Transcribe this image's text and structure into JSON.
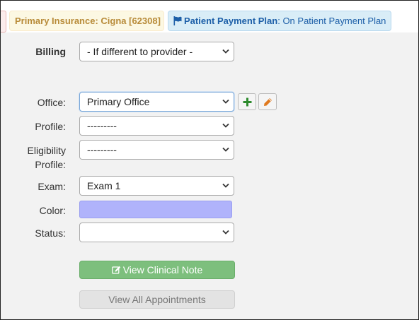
{
  "header": {
    "insurance_badge": "Primary Insurance: Cigna [62308]",
    "payment_plan_label": "Patient Payment Plan",
    "payment_plan_value": ": On Patient Payment Plan"
  },
  "form": {
    "billing": {
      "label": "Billing",
      "value": "- If different to provider -"
    },
    "office": {
      "label": "Office:",
      "value": "Primary Office"
    },
    "profile": {
      "label": "Profile:",
      "value": "---------"
    },
    "eligibility": {
      "label_line1": "Eligibility",
      "label_line2": "Profile:",
      "value": "---------"
    },
    "exam": {
      "label": "Exam:",
      "value": "Exam 1"
    },
    "color": {
      "label": "Color:",
      "swatch": "#b0b3fb"
    },
    "status": {
      "label": "Status:",
      "value": ""
    }
  },
  "buttons": {
    "view_clinical_note": "View Clinical Note",
    "view_all_appointments": "View All Appointments"
  },
  "icons": {
    "add": "plus-icon",
    "edit": "pencil-icon",
    "flag": "flag-icon",
    "note": "edit-note-icon"
  },
  "colors": {
    "add_icon": "#2e8b2e",
    "edit_icon": "#e07a1f",
    "green_button": "#7dbf7d",
    "plan_text": "#1d5fa8",
    "insurance_text": "#b88b39"
  }
}
